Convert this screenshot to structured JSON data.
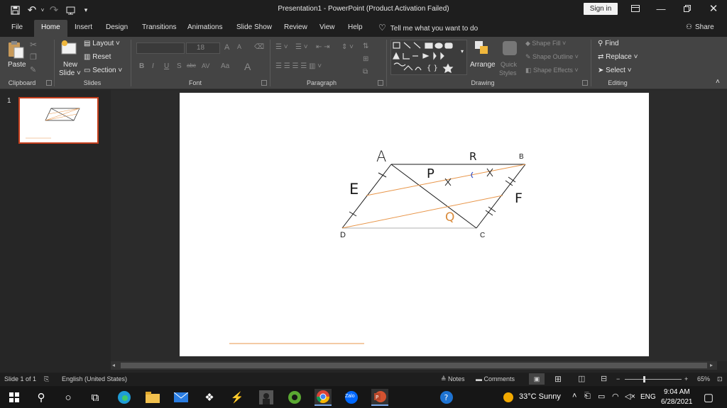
{
  "window": {
    "title": "Presentation1  -  PowerPoint (Product Activation Failed)",
    "sign_in": "Sign in",
    "icons": [
      "save-icon",
      "undo-icon",
      "redo-icon",
      "present-from-start-icon",
      "customize-icon",
      "ribbon-display-icon",
      "minimize-icon",
      "restore-icon",
      "close-icon"
    ]
  },
  "tabs": [
    "File",
    "Home",
    "Insert",
    "Design",
    "Transitions",
    "Animations",
    "Slide Show",
    "Review",
    "View",
    "Help"
  ],
  "active_tab": "Home",
  "tell_me": "Tell me what you want to do",
  "share": "Share",
  "ribbon": {
    "clipboard": {
      "label": "Clipboard",
      "paste": "Paste"
    },
    "slides": {
      "label": "Slides",
      "new_slide_line1": "New",
      "new_slide_line2": "Slide ˅",
      "layout": "Layout ˅",
      "reset": "Reset",
      "section": "Section ˅"
    },
    "font": {
      "label": "Font",
      "size": "18",
      "bold": "B",
      "italic": "I",
      "underline": "U",
      "strike": "S",
      "shadow": "abc",
      "spacing": "AV",
      "case": "Aa",
      "color": "A",
      "grow": "A",
      "shrink": "A"
    },
    "paragraph": {
      "label": "Paragraph"
    },
    "drawing": {
      "label": "Drawing",
      "arrange": "Arrange",
      "quick_styles_1": "Quick",
      "quick_styles_2": "Styles",
      "shape_fill": "Shape Fill ˅",
      "shape_outline": "Shape Outline ˅",
      "shape_effects": "Shape Effects ˅"
    },
    "editing": {
      "label": "Editing",
      "find": "Find",
      "replace": "Replace ˅",
      "select": "Select ˅"
    }
  },
  "thumbnails": {
    "slide_number": "1"
  },
  "slide": {
    "labels": {
      "A": "A",
      "B": "B",
      "C": "C",
      "D": "D",
      "E": "E",
      "F": "F",
      "P": "P",
      "Q": "Q",
      "R": "R"
    }
  },
  "status": {
    "slide_of": "Slide 1 of 1",
    "language": "English (United States)",
    "notes": "Notes",
    "comments": "Comments",
    "zoom": "65%"
  },
  "taskbar": {
    "weather": "33°C  Sunny",
    "lang": "ENG",
    "time": "9:04 AM",
    "date": "6/28/2021",
    "zalo": "Zalo"
  },
  "colors": {
    "accent": "#c43e1c",
    "slide_orange": "#e8964a",
    "ink": "#1a1a1a"
  }
}
